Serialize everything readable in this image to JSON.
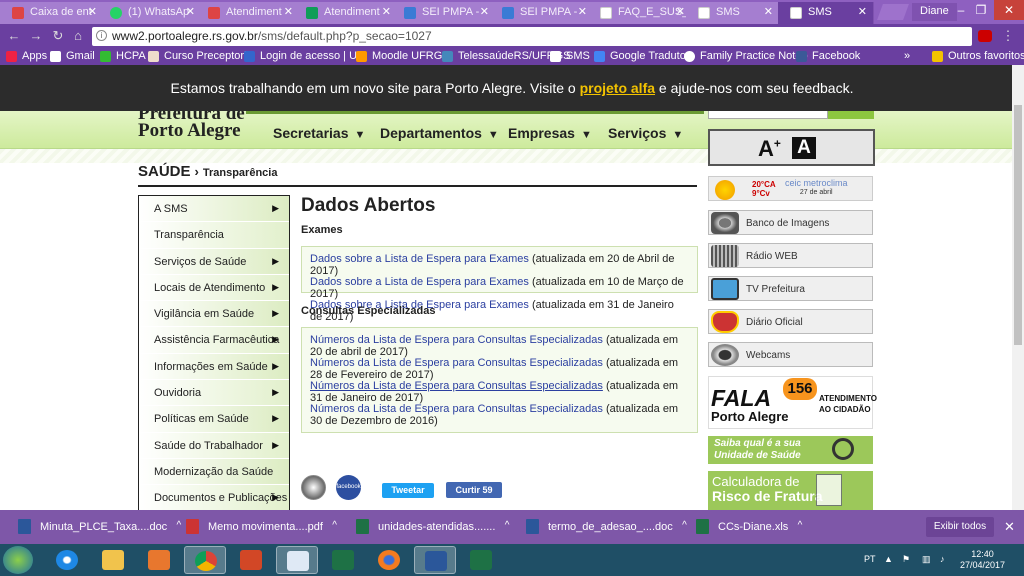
{
  "browser": {
    "tabs": [
      {
        "title": "Caixa de ent",
        "color": "#d44"
      },
      {
        "title": "(1) WhatsAp",
        "color": "#25d366"
      },
      {
        "title": "Atendiment",
        "color": "#d44"
      },
      {
        "title": "Atendiment",
        "color": "#0f9d58"
      },
      {
        "title": "SEI PMPA -",
        "color": "#3a7bd5"
      },
      {
        "title": "SEI PMPA -",
        "color": "#3a7bd5"
      },
      {
        "title": "FAQ_E_SUS_",
        "color": "#aaa"
      },
      {
        "title": "SMS",
        "color": "#aaa"
      },
      {
        "title": "SMS",
        "color": "#aaa"
      }
    ],
    "user": "Diane",
    "url_domain": "www2.portoalegre.rs.gov.br",
    "url_path": "/sms/default.php?p_secao=1027",
    "bookmarks": [
      "Apps",
      "Gmail",
      "HCPA",
      "Curso Preceptoria",
      "Login de acesso | UN",
      "Moodle UFRGS",
      "TelessaúdeRS/UFRGS",
      "SMS",
      "Google Tradutor",
      "Family Practice Noteb",
      "Facebook",
      "»",
      "Outros favoritos"
    ]
  },
  "notice": {
    "text_before": "Estamos trabalhando em um novo site para Porto Alegre. Visite o ",
    "link": "projeto alfa",
    "text_after": " e ajude-nos com seu feedback."
  },
  "header": {
    "logo_line1": "Prefeitura de",
    "logo_line2": "Porto Alegre",
    "nav": [
      "Secretarias",
      "Departamentos",
      "Empresas",
      "Serviços"
    ],
    "font_increase": "A",
    "font_increase_sup": "+",
    "font_contrast": "A"
  },
  "breadcrumb": {
    "section": "SAÚDE",
    "sep": "›",
    "current": "Transparência"
  },
  "leftmenu": [
    {
      "label": "A SMS",
      "arrow": true
    },
    {
      "label": "Transparência",
      "arrow": false
    },
    {
      "label": "Serviços de Saúde",
      "arrow": true
    },
    {
      "label": "Locais de Atendimento",
      "arrow": true
    },
    {
      "label": "Vigilância em Saúde",
      "arrow": true
    },
    {
      "label": "Assistência Farmacêutica",
      "arrow": true
    },
    {
      "label": "Informações em Saúde",
      "arrow": true
    },
    {
      "label": "Ouvidoria",
      "arrow": true
    },
    {
      "label": "Políticas em Saúde",
      "arrow": true
    },
    {
      "label": "Saúde do Trabalhador",
      "arrow": true
    },
    {
      "label": "Modernização da Saúde",
      "arrow": false
    },
    {
      "label": "Documentos e Publicações",
      "arrow": true
    }
  ],
  "content": {
    "title": "Dados Abertos",
    "exames_heading": "Exames",
    "exames": [
      {
        "link": "Dados sobre a Lista de Espera para Exames",
        "date": " (atualizada em 20 de Abril de 2017)"
      },
      {
        "link": "Dados sobre a Lista de Espera para Exames",
        "date": " (atualizada em 10 de Março de 2017)"
      },
      {
        "link": "Dados sobre a Lista de Espera para Exames",
        "date": " (atualizada em 31 de Janeiro de 2017)"
      }
    ],
    "consultas_heading": "Consultas Especializadas",
    "consultas": [
      {
        "link": "Números da Lista de Espera para Consultas Especializadas",
        "date": " (atualizada em 20 de abril de 2017)"
      },
      {
        "link": "Números da Lista de Espera para Consultas Especializadas",
        "date": " (atualizada em 28 de Fevereiro de 2017)"
      },
      {
        "link": "Números da Lista de Espera para Consultas Especializadas",
        "date": " (atualizada em 31 de Janeiro de 2017)"
      },
      {
        "link": "Números da Lista de Espera para Consultas Especializadas",
        "date": " (atualizada em 30 de Dezembro de 2016)"
      }
    ],
    "tweet": "Tweetar",
    "like": "Curtir 59",
    "facebook_badge": "facebook"
  },
  "sidebar": {
    "weather_temp": "20°CA",
    "weather_temp2": "9°Cv",
    "weather_brand": "ceic metroclima",
    "weather_date": "27 de abril",
    "items": [
      "Banco de Imagens",
      "Rádio WEB",
      "TV Prefeitura",
      "Diário Oficial",
      "Webcams"
    ],
    "fala_1": "FALA",
    "fala_num": "156",
    "fala_2": "Porto Alegre",
    "fala_3a": "ATENDIMENTO",
    "fala_3b": "AO CIDADÃO",
    "saiba_1": "Saiba qual é a sua",
    "saiba_2": "Unidade de Saúde",
    "calc_1": "Calculadora de",
    "calc_2": "Risco de Fratura"
  },
  "downloads": {
    "files": [
      "Minuta_PLCE_Taxa....doc",
      "Memo movimenta....pdf",
      "unidades-atendidas.......",
      "termo_de_adesao_....doc",
      "CCs-Diane.xls"
    ],
    "show_all": "Exibir todos"
  },
  "taskbar": {
    "lang": "PT",
    "time": "12:40",
    "date": "27/04/2017"
  },
  "colors": {
    "accent": "#8cc63f",
    "browser": "#6a3fa0",
    "link": "#2b3fa0"
  }
}
